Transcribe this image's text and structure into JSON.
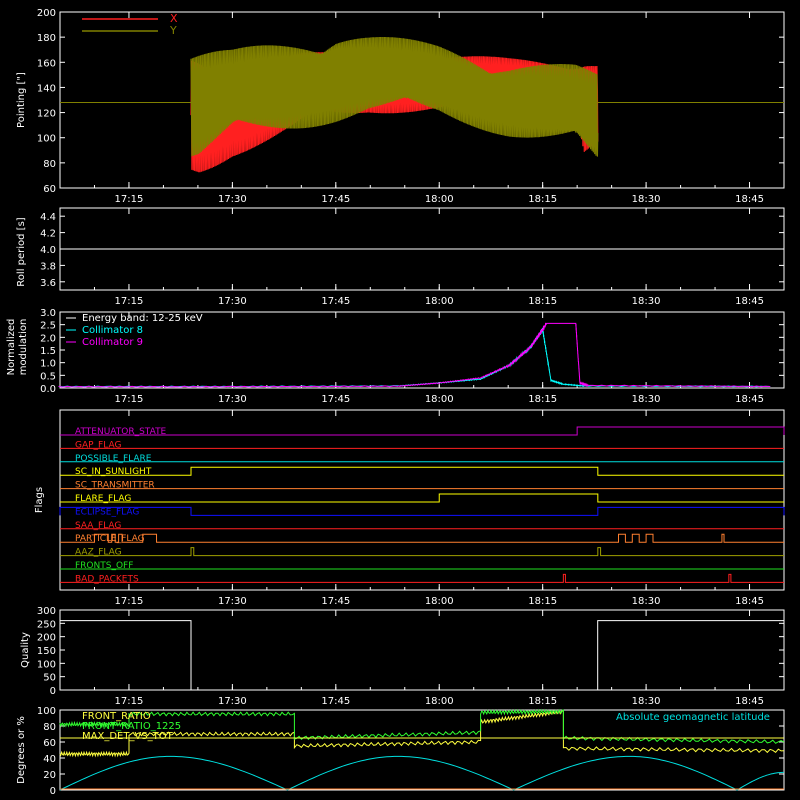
{
  "chart_data": [
    {
      "type": "line",
      "ylabel": "Pointing [\"]",
      "ylim": [
        60,
        200
      ],
      "yticks": [
        60,
        80,
        100,
        120,
        140,
        160,
        180,
        200
      ],
      "xticks": [
        "17:15",
        "17:30",
        "17:45",
        "18:00",
        "18:15",
        "18:30",
        "18:45"
      ],
      "legend_position": "top-left",
      "series": [
        {
          "name": "X",
          "color": "#ff2020",
          "data_start": "17:24",
          "data_end": "18:23",
          "upper_envelope": [
            [
              17.42,
              168
            ],
            [
              17.5,
              160
            ],
            [
              17.67,
              168
            ],
            [
              17.83,
              168
            ],
            [
              18.0,
              166
            ],
            [
              18.17,
              164
            ],
            [
              18.33,
              164
            ],
            [
              18.35,
              172
            ],
            [
              18.38,
              166
            ]
          ],
          "lower_envelope": [
            [
              17.42,
              68
            ],
            [
              17.5,
              85
            ],
            [
              17.67,
              105
            ],
            [
              17.83,
              118
            ],
            [
              18.0,
              122
            ],
            [
              18.17,
              124
            ],
            [
              18.33,
              123
            ],
            [
              18.35,
              88
            ],
            [
              18.38,
              95
            ]
          ],
          "baseline": 128
        },
        {
          "name": "Y",
          "color": "#808000",
          "data_start": "17:24",
          "data_end": "18:23",
          "upper_envelope": [
            [
              17.42,
              170
            ],
            [
              17.5,
              170
            ],
            [
              17.75,
              188
            ],
            [
              17.83,
              183
            ],
            [
              18.0,
              175
            ],
            [
              18.17,
              163
            ],
            [
              18.33,
              158
            ],
            [
              18.38,
              152
            ]
          ],
          "lower_envelope": [
            [
              17.42,
              80
            ],
            [
              17.5,
              95
            ],
            [
              17.75,
              112
            ],
            [
              17.83,
              118
            ],
            [
              18.0,
              116
            ],
            [
              18.17,
              100
            ],
            [
              18.33,
              88
            ],
            [
              18.38,
              74
            ]
          ],
          "baseline": 128
        }
      ]
    },
    {
      "type": "line",
      "ylabel": "Roll period [s]",
      "ylim": [
        3.5,
        4.5
      ],
      "yticks": [
        "3.6",
        "3.8",
        "4.0",
        "4.2",
        "4.4"
      ],
      "xticks": [
        "17:15",
        "17:30",
        "17:45",
        "18:00",
        "18:15",
        "18:30",
        "18:45"
      ],
      "series": [
        {
          "name": "",
          "color": "#ffffff",
          "x": [
            "17:05",
            "18:50"
          ],
          "y": [
            4.0,
            4.0
          ]
        }
      ]
    },
    {
      "type": "line",
      "ylabel": "Normalized modulation",
      "ylim": [
        0,
        3
      ],
      "yticks": [
        "0.0",
        "0.5",
        "1.0",
        "1.5",
        "2.0",
        "2.5",
        "3.0"
      ],
      "xticks": [
        "17:15",
        "17:30",
        "17:45",
        "18:00",
        "18:15",
        "18:30",
        "18:45"
      ],
      "annotation": "Energy band: 12-25 keV",
      "legend_position": "top-left",
      "series": [
        {
          "name": "Collimator 8",
          "color": "#00ffff",
          "x": [
            17.08,
            17.5,
            17.9,
            18.0,
            18.1,
            18.17,
            18.22,
            18.25,
            18.27,
            18.3,
            18.35,
            18.8
          ],
          "y": [
            0.06,
            0.06,
            0.08,
            0.2,
            0.35,
            0.9,
            1.6,
            2.3,
            0.3,
            0.15,
            0.08,
            0.06
          ]
        },
        {
          "name": "Collimator 9",
          "color": "#ff00ff",
          "x": [
            17.08,
            17.5,
            17.9,
            18.0,
            18.1,
            18.17,
            18.22,
            18.26,
            18.27,
            18.33,
            18.34,
            18.36,
            18.8
          ],
          "y": [
            0.05,
            0.05,
            0.07,
            0.2,
            0.4,
            0.9,
            1.6,
            2.55,
            2.55,
            2.55,
            0.2,
            0.1,
            0.06
          ]
        }
      ]
    },
    {
      "type": "line",
      "ylabel": "Flags",
      "xticks": [
        "17:15",
        "17:30",
        "17:45",
        "18:00",
        "18:15",
        "18:30",
        "18:45"
      ],
      "flags": [
        {
          "name": "ATTENUATOR_STATE",
          "color": "#cc00cc",
          "on": [
            [
              "18:20",
              "18:50"
            ]
          ]
        },
        {
          "name": "GAP_FLAG",
          "color": "#ff2020",
          "on": []
        },
        {
          "name": "POSSIBLE_FLARE",
          "color": "#00dddd",
          "on": []
        },
        {
          "name": "SC_IN_SUNLIGHT",
          "color": "#ffff00",
          "on": [
            [
              "17:24",
              "18:23"
            ]
          ]
        },
        {
          "name": "SC_TRANSMITTER",
          "color": "#ff8030",
          "on": []
        },
        {
          "name": "FLARE_FLAG",
          "color": "#ffff00",
          "on": [
            [
              "18:00",
              "18:23"
            ]
          ]
        },
        {
          "name": "ECLIPSE_FLAG",
          "color": "#1010ff",
          "on": [
            [
              "17:05",
              "17:24"
            ],
            [
              "18:23",
              "18:50"
            ]
          ]
        },
        {
          "name": "SAA_FLAG",
          "color": "#ff2020",
          "on": []
        },
        {
          "name": "PARTICLE_FLAG",
          "color": "#ff8030",
          "on": [
            [
              "17:10",
              "17:12"
            ],
            [
              "17:12.5",
              "17:13"
            ],
            [
              "17:13.5",
              "17:14"
            ],
            [
              "17:17",
              "17:19"
            ],
            [
              "18:26",
              "18:27"
            ],
            [
              "18:28",
              "18:29"
            ],
            [
              "18:30",
              "18:31"
            ],
            [
              "18:41",
              "18:41.3"
            ]
          ]
        },
        {
          "name": "AAZ_FLAG",
          "color": "#a0a000",
          "on": [
            [
              "17:24",
              "17:24.4"
            ],
            [
              "18:23",
              "18:23.4"
            ]
          ]
        },
        {
          "name": "FRONTS_OFF",
          "color": "#20e020",
          "on": []
        },
        {
          "name": "BAD_PACKETS",
          "color": "#ff2020",
          "on": [
            [
              "18:18",
              "18:18.3"
            ],
            [
              "18:42",
              "18:42.3"
            ]
          ]
        }
      ]
    },
    {
      "type": "line",
      "ylabel": "Quality",
      "ylim": [
        0,
        300
      ],
      "yticks": [
        "0",
        "50",
        "100",
        "150",
        "200",
        "250",
        "300"
      ],
      "xticks": [
        "17:15",
        "17:30",
        "17:45",
        "18:00",
        "18:15",
        "18:30",
        "18:45"
      ],
      "series": [
        {
          "name": "",
          "color": "#ffffff",
          "x": [
            17.083,
            17.4,
            17.4,
            18.383,
            18.383,
            18.833
          ],
          "y": [
            260,
            260,
            0,
            0,
            260,
            260
          ]
        }
      ]
    },
    {
      "type": "line",
      "ylabel": "Degrees or %",
      "ylim": [
        0,
        100
      ],
      "yticks": [
        "0",
        "20",
        "40",
        "60",
        "80",
        "100"
      ],
      "xticks": [
        "17:15",
        "17:30",
        "17:45",
        "18:00",
        "18:15",
        "18:30",
        "18:45"
      ],
      "legend_position": "top-left",
      "series": [
        {
          "name": "FRONT_RATIO",
          "color": "#ffff40",
          "x": [
            17.083,
            17.25,
            17.25,
            17.65,
            17.65,
            18.1,
            18.1,
            18.3,
            18.3,
            18.833
          ],
          "y": [
            45,
            45,
            70,
            70,
            55,
            60,
            85,
            98,
            52,
            49
          ]
        },
        {
          "name": "FRONT_RATIO_1225",
          "color": "#30ff30",
          "x": [
            17.083,
            17.25,
            17.25,
            17.65,
            17.65,
            18.1,
            18.1,
            18.3,
            18.3,
            18.833
          ],
          "y": [
            82,
            82,
            95,
            95,
            65,
            72,
            97,
            98,
            65,
            60
          ]
        },
        {
          "name": "MAX_DET_VS_TOT",
          "color": "#ffff40",
          "x": [
            17.083,
            17.25,
            17.25,
            18.833
          ],
          "y": [
            65,
            65,
            65,
            65
          ]
        },
        {
          "name": "Absolute geomagnetic latitude",
          "color": "#00e0e0",
          "x": [
            17.083,
            17.35,
            17.633,
            17.9,
            18.18,
            18.46,
            18.72,
            18.833
          ],
          "y": [
            0,
            42,
            0,
            42,
            0,
            42,
            0,
            22
          ]
        }
      ]
    }
  ]
}
